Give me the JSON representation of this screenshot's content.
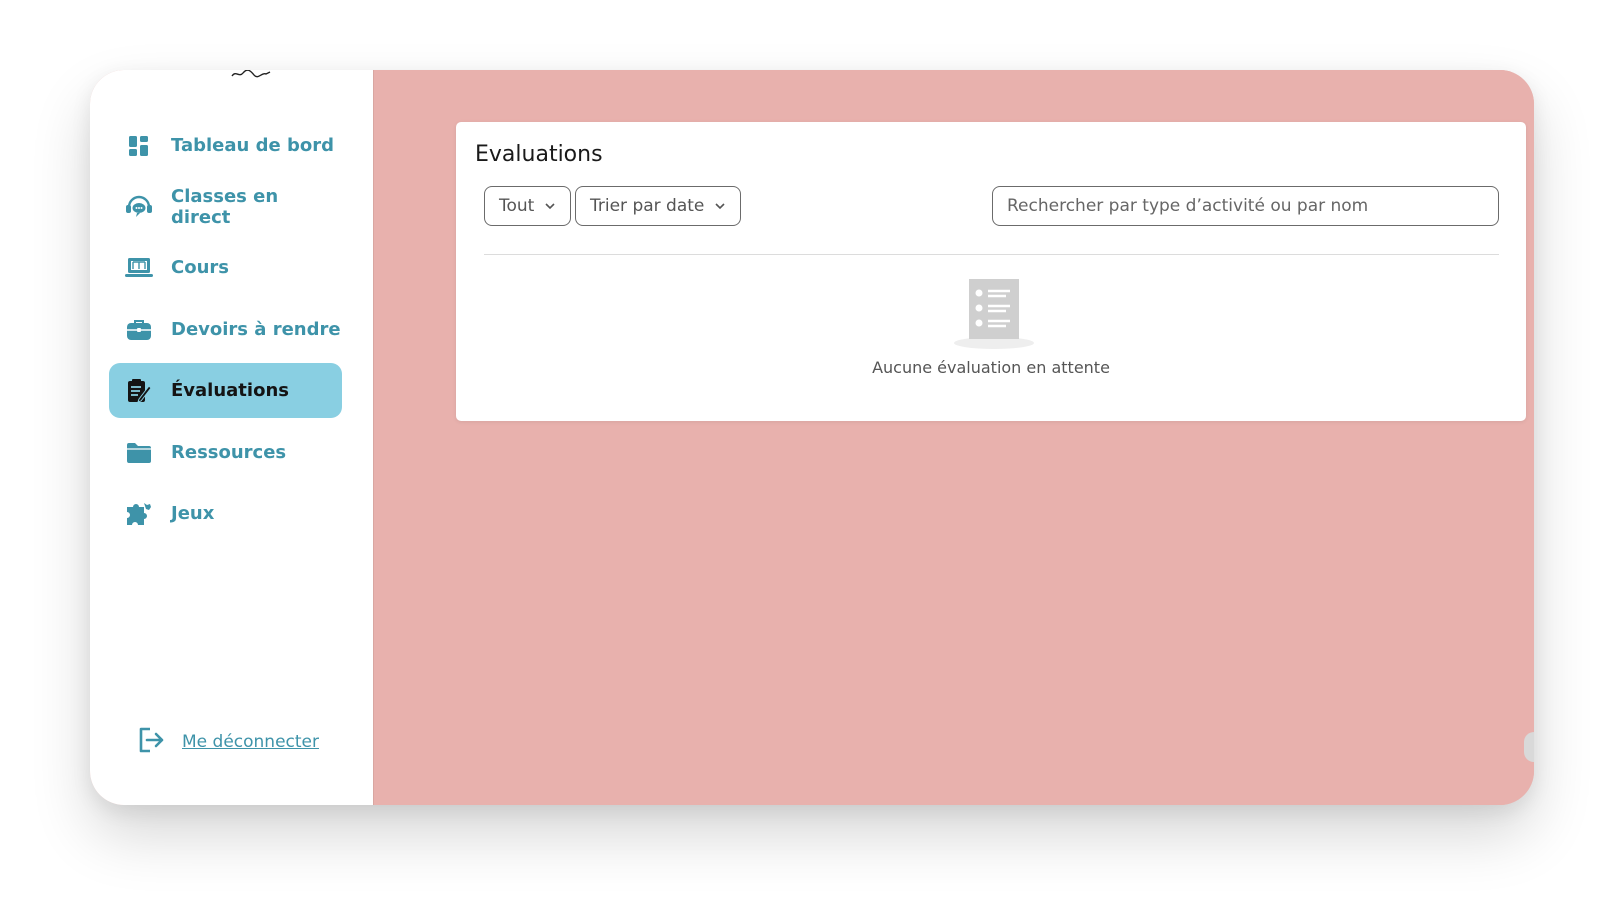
{
  "sidebar": {
    "items": [
      {
        "label": "Tableau de bord",
        "icon": "dashboard-icon"
      },
      {
        "label": "Classes en direct",
        "icon": "headset-chat-icon"
      },
      {
        "label": "Cours",
        "icon": "laptop-book-icon"
      },
      {
        "label": "Devoirs à rendre",
        "icon": "briefcase-icon"
      },
      {
        "label": "Évaluations",
        "icon": "edit-document-icon",
        "active": true
      },
      {
        "label": "Ressources",
        "icon": "folder-icon"
      },
      {
        "label": "Jeux",
        "icon": "puzzle-icon"
      }
    ],
    "logout_label": "Me déconnecter"
  },
  "main": {
    "card_title": "Evaluations",
    "filter_label": "Tout",
    "sort_label": "Trier par date",
    "search_placeholder": "Rechercher par type d’activité ou par nom",
    "empty_message": "Aucune évaluation en attente"
  },
  "colors": {
    "accent": "#3e93a9",
    "active_bg": "#89cfe2",
    "main_bg": "#e8b1ad"
  }
}
